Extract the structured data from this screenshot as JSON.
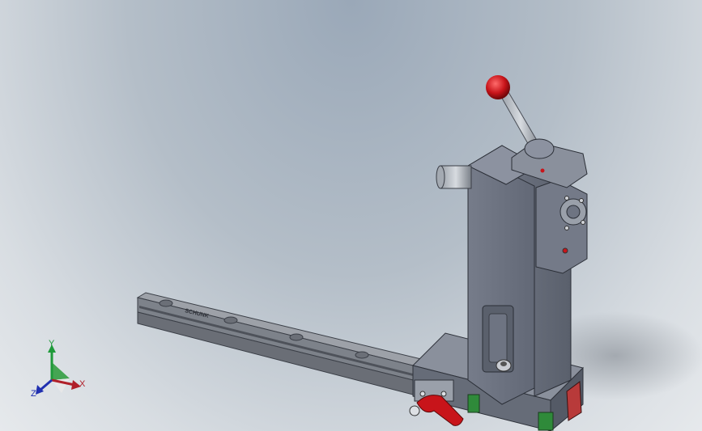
{
  "viewport": {
    "background_top": "#9aa8b8",
    "background_bottom": "#e6e9ec"
  },
  "model": {
    "rail_label": "SCHUNK",
    "knob_color": "#c8141a",
    "clamp_handle_color": "#c8141a",
    "body_color": "#6a7080",
    "rail_color": "#8a8e96",
    "accent_green": "#2f8a3a"
  },
  "triad": {
    "x_label": "X",
    "y_label": "Y",
    "z_label": "Z",
    "x_color": "#b0202a",
    "y_color": "#1f9a3a",
    "z_color": "#2030b0"
  }
}
